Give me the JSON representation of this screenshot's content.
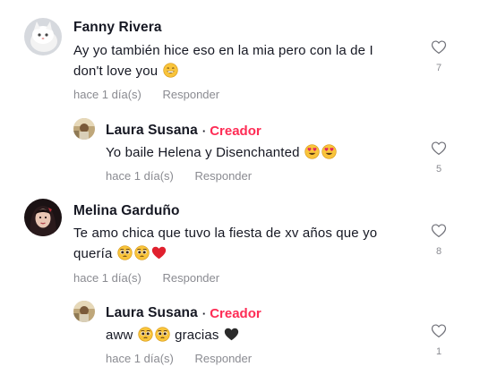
{
  "comments": [
    {
      "author": "Fanny Rivera",
      "text_lines": [
        "Ay yo también hice eso en la mia pero con la de I",
        "don't love you"
      ],
      "time": "hace 1 día(s)",
      "reply_label": "Responder",
      "likes": "7"
    },
    {
      "author": "Laura Susana",
      "dot": "·",
      "badge": "Creador",
      "text": "Yo baile Helena y Disenchanted",
      "time": "hace 1 día(s)",
      "reply_label": "Responder",
      "likes": "5"
    },
    {
      "author": "Melina Garduño",
      "text_lines": [
        "Te amo chica que tuvo la fiesta de xv años que yo",
        "quería"
      ],
      "time": "hace 1 día(s)",
      "reply_label": "Responder",
      "likes": "8"
    },
    {
      "author": "Laura Susana",
      "dot": "·",
      "badge": "Creador",
      "text_a": "aww",
      "text_b": "gracias",
      "time": "hace 1 día(s)",
      "reply_label": "Responder",
      "likes": "1"
    }
  ],
  "colors": {
    "creator_badge": "#fe2c55",
    "meta": "#8a8b91",
    "text": "#161823"
  },
  "icons": [
    "heart-outline-icon",
    "grinning-face-emoji",
    "heart-eyes-emoji",
    "pleading-face-emoji",
    "red-heart-emoji",
    "black-heart-emoji"
  ]
}
